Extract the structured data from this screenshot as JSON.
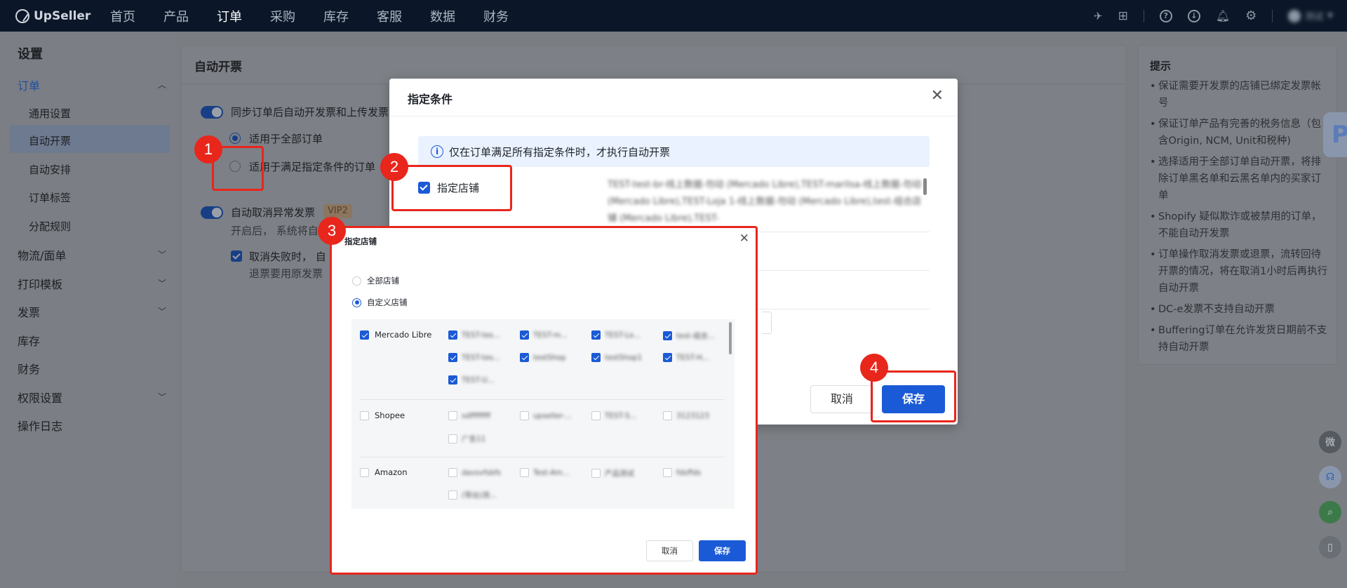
{
  "topnav": {
    "brand": "UpSeller",
    "items": [
      "首页",
      "产品",
      "订单",
      "采购",
      "库存",
      "客服",
      "数据",
      "财务"
    ],
    "active_index": 2,
    "user_name": "测试"
  },
  "sidebar": {
    "title": "设置",
    "order_group": "订单",
    "sub_items": [
      "通用设置",
      "自动开票",
      "自动安排",
      "订单标签",
      "分配规则"
    ],
    "active_sub": "自动开票",
    "items": [
      "物流/面单",
      "打印模板",
      "发票",
      "库存",
      "财务",
      "权限设置",
      "操作日志"
    ]
  },
  "main": {
    "title": "自动开票",
    "sync_label": "同步订单后自动开发票和上传发票",
    "radio_all": "适用于全部订单",
    "radio_cond": "适用于满足指定条件的订单",
    "cancel_label": "自动取消异常发票",
    "vip_badge": "VIP2",
    "cancel_desc": "开启后， 系统将自",
    "cancel_fail": "取消失败时， 自",
    "cancel_fail_desc": "退票要用原发票"
  },
  "tips": {
    "title": "提示",
    "items": [
      "保证需要开发票的店铺已绑定发票帐号",
      "保证订单产品有完善的税务信息（包含Origin, NCM, Unit和税种)",
      "选择适用于全部订单自动开票，将排除订单黑名单和云黑名单内的买家订单",
      "Shopify 疑似欺诈或被禁用的订单，不能自动开发票",
      "订单操作取消发票或退票，流转回待开票的情况，将在取消1小时后再执行自动开票",
      "DC-e发票不支持自动开票",
      "Buffering订单在允许发货日期前不支持自动开票"
    ]
  },
  "cond_dialog": {
    "title": "指定条件",
    "info": "仅在订单满足所有指定条件时，才执行自动开票",
    "store_check": "指定店铺",
    "store_summary": "TEST-test-br-线上数据-勿动 (Mercado Libre),TEST-marilsa-线上数据-勿动 (Mercado Libre),TEST-Loja 1-线上数据-勿动 (Mercado Libre),test-组合店铺 (Mercado Libre),TEST-",
    "cancel": "取消",
    "save": "保存"
  },
  "store_dialog": {
    "title": "指定店铺",
    "radio_all": "全部店铺",
    "radio_custom": "自定义店铺",
    "platforms": [
      {
        "name": "Mercado Libre",
        "checked": true,
        "shops": [
          "TEST-tes...",
          "TEST-m...",
          "TEST-Lo...",
          "test-组合...",
          "TEST-tes...",
          "testShop",
          "testShop1",
          "TEST-H...",
          "TEST-U..."
        ]
      },
      {
        "name": "Shopee",
        "checked": false,
        "shops": [
          "sdffffffff",
          "upseller-...",
          "TEST-S...",
          "3123123",
          "广告11"
        ]
      },
      {
        "name": "Amazon",
        "checked": false,
        "shops": [
          "davsvfsbfs",
          "Test-Am...",
          "产品测试",
          "fdsffds",
          "(导出)测..."
        ]
      }
    ],
    "cancel": "取消",
    "save": "保存"
  },
  "annotations": {
    "b1": "1",
    "b2": "2",
    "b3": "3",
    "b4": "4"
  },
  "colors": {
    "highlight": "#e8261c",
    "primary": "#1b5ad6",
    "nav_bg": "#0b1728"
  }
}
